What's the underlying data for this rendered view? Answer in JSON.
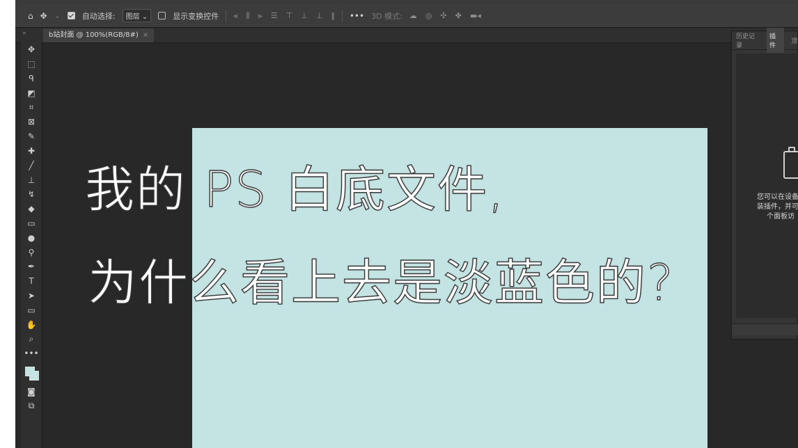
{
  "options_bar": {
    "home_icon": "home-icon",
    "move_icon": "move-icon",
    "auto_select_label": "自动选择:",
    "auto_select_checked": true,
    "auto_select_value": "图层",
    "show_transform_label": "显示变换控件",
    "show_transform_checked": false,
    "more_label": "•••",
    "mode_3d_label": "3D 模式:"
  },
  "document": {
    "tab_label": "b站封面 @ 100%(RGB/8#)",
    "tab_close": "×",
    "background_color": "#c4e4e4"
  },
  "toolbar": {
    "tools": [
      {
        "name": "move-tool",
        "glyph": "✥"
      },
      {
        "name": "marquee-tool",
        "glyph": "⬚"
      },
      {
        "name": "lasso-tool",
        "glyph": "ᑫ"
      },
      {
        "name": "object-select-tool",
        "glyph": "◩"
      },
      {
        "name": "crop-tool",
        "glyph": "⌗"
      },
      {
        "name": "frame-tool",
        "glyph": "⊠"
      },
      {
        "name": "eyedropper-tool",
        "glyph": "✎"
      },
      {
        "name": "healing-brush-tool",
        "glyph": "✚"
      },
      {
        "name": "brush-tool",
        "glyph": "╱"
      },
      {
        "name": "clone-stamp-tool",
        "glyph": "⊥"
      },
      {
        "name": "history-brush-tool",
        "glyph": "↯"
      },
      {
        "name": "eraser-tool",
        "glyph": "◆"
      },
      {
        "name": "gradient-tool",
        "glyph": "▭"
      },
      {
        "name": "blur-tool",
        "glyph": "●"
      },
      {
        "name": "dodge-tool",
        "glyph": "⚲"
      },
      {
        "name": "pen-tool",
        "glyph": "✒"
      },
      {
        "name": "type-tool",
        "glyph": "T"
      },
      {
        "name": "path-select-tool",
        "glyph": "➤"
      },
      {
        "name": "rectangle-tool",
        "glyph": "▭"
      },
      {
        "name": "hand-tool",
        "glyph": "✋"
      },
      {
        "name": "zoom-tool",
        "glyph": "⌕"
      },
      {
        "name": "edit-toolbar",
        "glyph": "•••"
      }
    ],
    "foreground_color": "#c3e3e3",
    "background_color": "#c3e3e3"
  },
  "right_panel": {
    "tabs": [
      "历史记录",
      "插件",
      "顶"
    ],
    "active_tab": "插件",
    "message_line1": "您可以在设备",
    "message_line2": "装插件，并可",
    "message_line3": "个面板访"
  },
  "caption": {
    "line1": "我的 PS 白底文件,",
    "line2": "为什么看上去是淡蓝色的?"
  }
}
